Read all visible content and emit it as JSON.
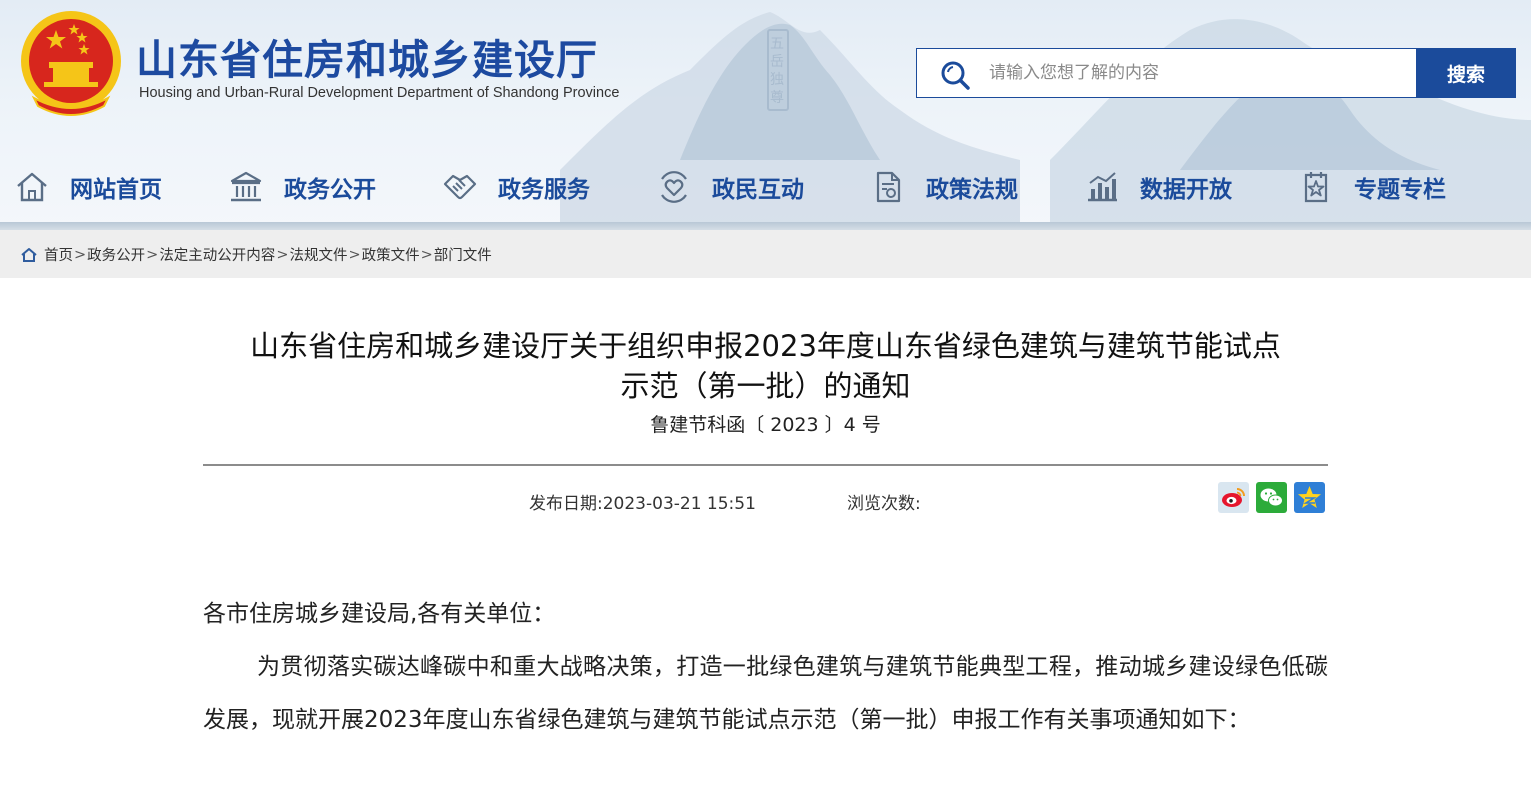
{
  "header": {
    "site_title": "山东省住房和城乡建设厅",
    "site_subtitle": "Housing and Urban-Rural Development Department of Shandong Province",
    "emblem_icon": "national-emblem-icon",
    "search": {
      "placeholder": "请输入您想了解的内容",
      "button_label": "搜索"
    }
  },
  "nav": {
    "items": [
      {
        "label": "网站首页",
        "icon": "home-icon"
      },
      {
        "label": "政务公开",
        "icon": "government-building-icon"
      },
      {
        "label": "政务服务",
        "icon": "handshake-icon"
      },
      {
        "label": "政民互动",
        "icon": "heart-chat-icon"
      },
      {
        "label": "政策法规",
        "icon": "document-icon"
      },
      {
        "label": "数据开放",
        "icon": "bar-chart-icon"
      },
      {
        "label": "专题专栏",
        "icon": "star-document-icon"
      }
    ]
  },
  "breadcrumb": {
    "items": [
      "首页",
      "政务公开",
      "法定主动公开内容",
      "法规文件",
      "政策文件",
      "部门文件"
    ],
    "separator": ">"
  },
  "article": {
    "title_line1": "山东省住房和城乡建设厅关于组织申报2023年度山东省绿色建筑与建筑节能试点",
    "title_line2": "示范（第一批）的通知",
    "doc_number": "鲁建节科函〔 2023 〕4 号",
    "publish_date": "发布日期:2023-03-21 15:51",
    "views_label": "浏览次数:",
    "share_icons": [
      "weibo-icon",
      "wechat-icon",
      "qzone-icon"
    ],
    "salutation": "各市住房城乡建设局,各有关单位：",
    "paragraph1": "为贯彻落实碳达峰碳中和重大战略决策，打造一批绿色建筑与建筑节能典型工程，推动城乡建设绿色低碳发展，现就开展2023年度山东省绿色建筑与建筑节能试点示范（第一批）申报工作有关事项通知如下："
  },
  "colors": {
    "brand_blue": "#1b4b9b",
    "title_blue": "#1d4aa0",
    "emblem_red": "#d7261d",
    "emblem_gold": "#f5c518",
    "breadcrumb_bg": "#eeeeee"
  }
}
